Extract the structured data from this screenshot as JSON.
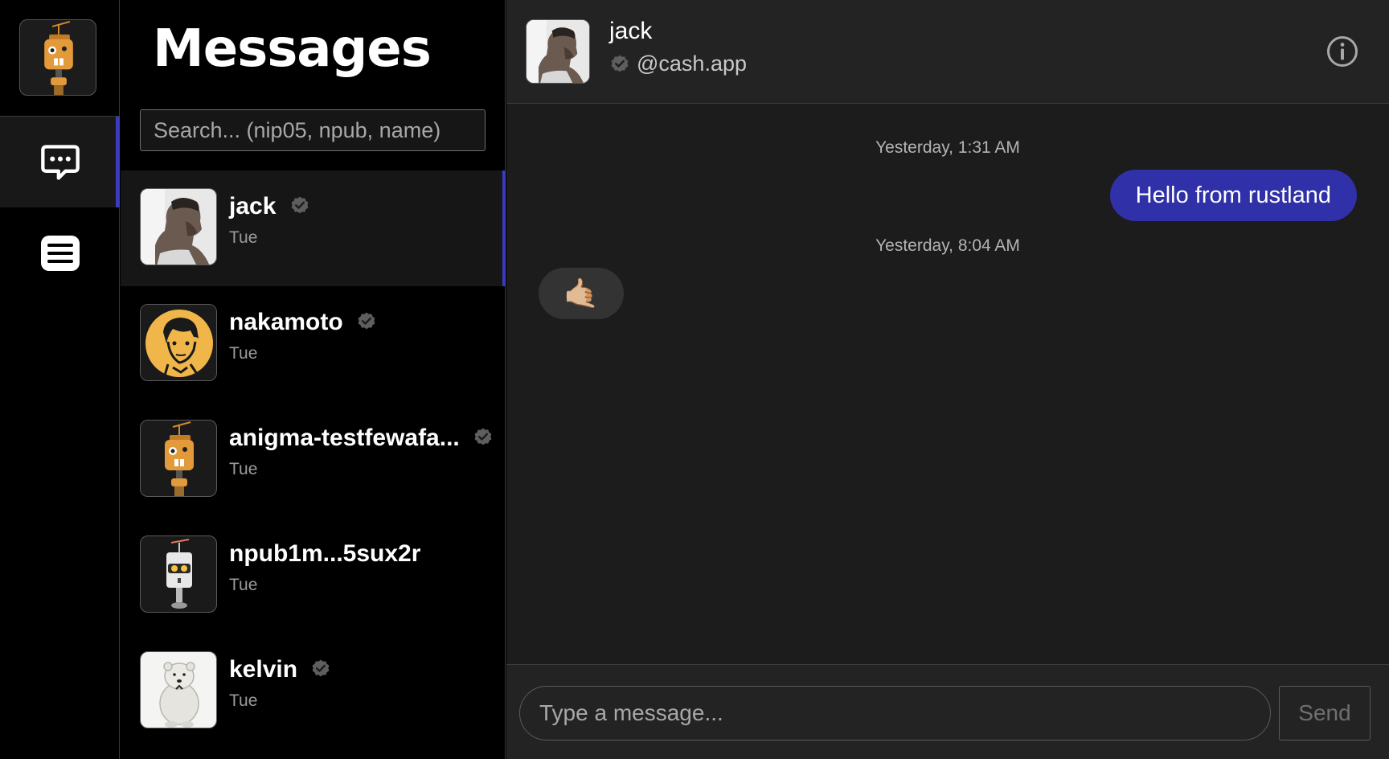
{
  "app": {
    "logo_icon": "robot-icon"
  },
  "rail": {
    "items": [
      {
        "name": "messages",
        "icon": "chat-bubble-icon",
        "active": true
      },
      {
        "name": "menu",
        "icon": "menu-icon",
        "active": false
      }
    ]
  },
  "conversations": {
    "title": "Messages",
    "search_placeholder": "Search... (nip05, npub, name)",
    "items": [
      {
        "name": "jack",
        "time": "Tue",
        "verified": true,
        "active": true,
        "avatar": "portrait-photo-icon"
      },
      {
        "name": "nakamoto",
        "time": "Tue",
        "verified": true,
        "active": false,
        "avatar": "face-sketch-icon"
      },
      {
        "name": "anigma-testfewafa...",
        "time": "Tue",
        "verified": true,
        "active": false,
        "avatar": "robot-icon"
      },
      {
        "name": "npub1m...5sux2r",
        "time": "Tue",
        "verified": false,
        "active": false,
        "avatar": "white-robot-icon"
      },
      {
        "name": "kelvin",
        "time": "Tue",
        "verified": true,
        "active": false,
        "avatar": "polar-bear-icon"
      }
    ]
  },
  "chat": {
    "header": {
      "name": "jack",
      "handle": "@cash.app",
      "verified": true,
      "info_icon": "info-icon"
    },
    "messages": [
      {
        "type": "timestamp",
        "text": "Yesterday, 1:31 AM"
      },
      {
        "type": "outgoing",
        "text": "Hello from rustland"
      },
      {
        "type": "timestamp",
        "text": "Yesterday, 8:04 AM"
      },
      {
        "type": "incoming",
        "text": "🤙🏼"
      }
    ],
    "composer": {
      "placeholder": "Type a message...",
      "send_label": "Send"
    }
  },
  "colors": {
    "accent": "#3b3bbf",
    "bubble_out": "#3030a8",
    "background": "#000000",
    "chat_bg": "#1c1c1c",
    "panel": "#232323"
  }
}
